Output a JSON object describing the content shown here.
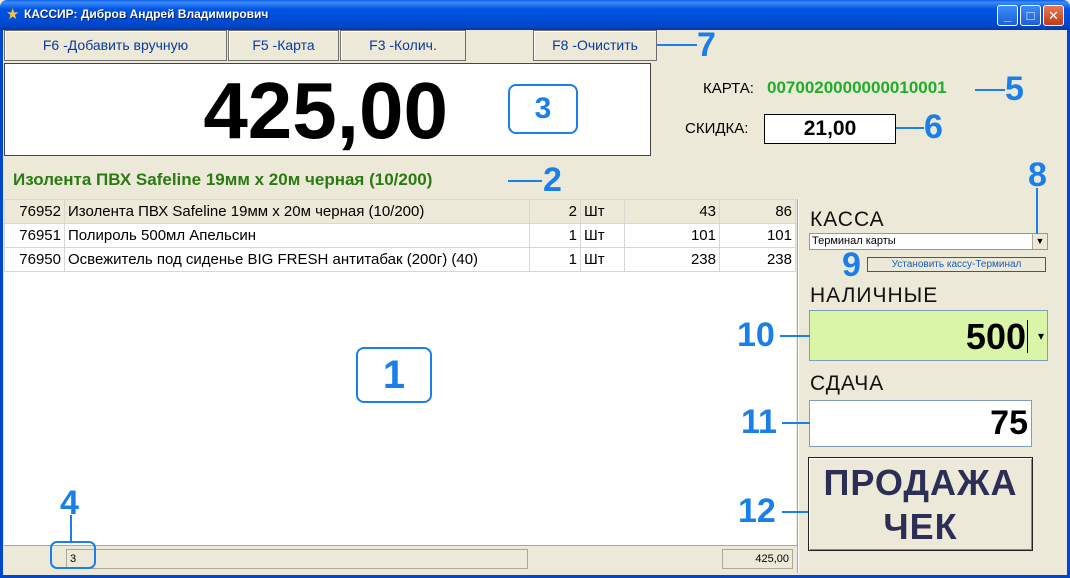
{
  "window": {
    "title": "КАССИР: Дибров Андрей Владимирович",
    "minimize": "_",
    "maximize": "□",
    "close": "✕"
  },
  "toolbar": {
    "add_manual": "F6 -Добавить вручную",
    "card": "F5 -Карта",
    "qty": "F3 -Колич.",
    "clear": "F8 -Очистить"
  },
  "total": {
    "amount": "425,00",
    "qty_marker": "3"
  },
  "card": {
    "label": "КАРТА:",
    "number": "0070020000000010001"
  },
  "discount": {
    "label": "СКИДКА:",
    "value": "21,00"
  },
  "current_product": "Изолента ПВХ Safeline 19мм х 20м черная (10/200)",
  "items": [
    {
      "code": "76952",
      "name": "Изолента ПВХ Safeline 19мм х 20м черная (10/200)",
      "qty": "2",
      "unit": "Шт",
      "price": "43",
      "sum": "86"
    },
    {
      "code": "76951",
      "name": "Полироль 500мл Апельсин",
      "qty": "1",
      "unit": "Шт",
      "price": "101",
      "sum": "101"
    },
    {
      "code": "76950",
      "name": "Освежитель под сиденье BIG FRESH антитабак (200г) (40)",
      "qty": "1",
      "unit": "Шт",
      "price": "238",
      "sum": "238"
    }
  ],
  "list_marker": "1",
  "status": {
    "count": "3",
    "total": "425,00"
  },
  "kassa": {
    "label": "КАССА",
    "selected": "Терминал карты",
    "set_terminal": "Установить кассу-Терминал"
  },
  "cash": {
    "label": "НАЛИЧНЫЕ",
    "value": "500"
  },
  "change": {
    "label": "СДАЧА",
    "value": "75"
  },
  "sale_button": {
    "line1": "ПРОДАЖА",
    "line2": "ЧЕК"
  },
  "annotations": {
    "n1": "1",
    "n2": "2",
    "n4": "4",
    "n5": "5",
    "n6": "6",
    "n7": "7",
    "n8": "8",
    "n9": "9",
    "n10": "10",
    "n11": "11",
    "n12": "12"
  },
  "colors": {
    "annotation": "#1a7fe8",
    "card_number": "#1fae2a",
    "product_name": "#2b7a12",
    "cash_field": "#d8f5a8",
    "button_text": "#0a3a9a"
  }
}
